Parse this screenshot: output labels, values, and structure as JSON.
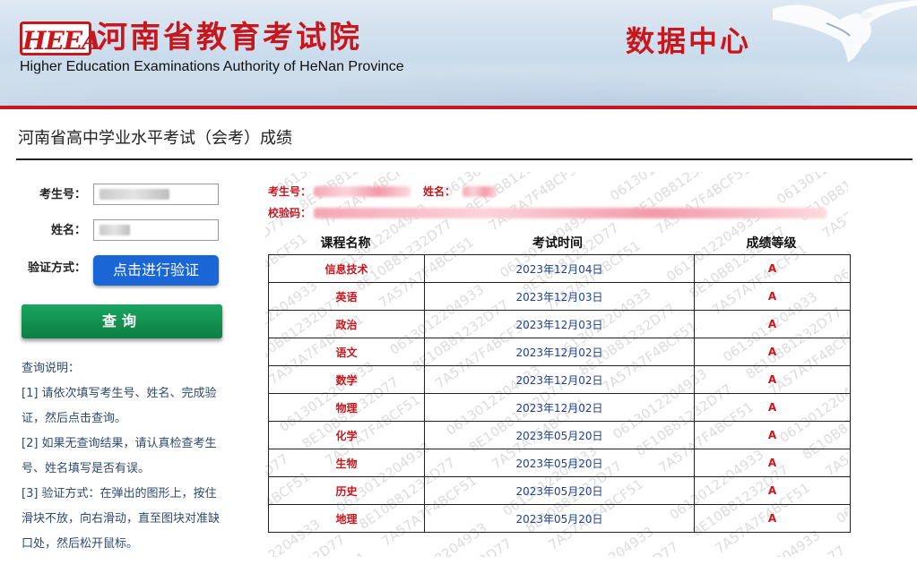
{
  "header": {
    "logo_text": "HEEA",
    "org_name_cn": "河南省教育考试院",
    "org_name_en": "Higher Education Examinations Authority of HeNan Province",
    "section_title": "数据中心"
  },
  "page": {
    "title": "河南省高中学业水平考试（会考）成绩"
  },
  "form": {
    "exam_no_label": "考生号：",
    "name_label": "姓名：",
    "verify_label": "验证方式：",
    "verify_button": "点击进行验证",
    "query_button": "查询"
  },
  "notes": {
    "heading": "查询说明：",
    "items": [
      "[1] 请依次填写考生号、姓名、完成验证，然后点击查询。",
      "[2] 如果无查询结果，请认真检查考生号、姓名填写是否有误。",
      "[3] 验证方式：在弹出的图形上，按住滑块不放，向右滑动，直至图块对准缺口处，然后松开鼠标。"
    ]
  },
  "result": {
    "exam_no_label": "考生号：",
    "name_label": "姓名：",
    "checksum_label": "校验码：",
    "columns": [
      "课程名称",
      "考试时间",
      "成绩等级"
    ],
    "rows": [
      {
        "course": "信息技术",
        "date": "2023年12月04日",
        "grade": "A"
      },
      {
        "course": "英语",
        "date": "2023年12月03日",
        "grade": "A"
      },
      {
        "course": "政治",
        "date": "2023年12月03日",
        "grade": "A"
      },
      {
        "course": "语文",
        "date": "2023年12月02日",
        "grade": "A"
      },
      {
        "course": "数学",
        "date": "2023年12月02日",
        "grade": "A"
      },
      {
        "course": "物理",
        "date": "2023年12月02日",
        "grade": "A"
      },
      {
        "course": "化学",
        "date": "2023年05月20日",
        "grade": "A"
      },
      {
        "course": "生物",
        "date": "2023年05月20日",
        "grade": "A"
      },
      {
        "course": "历史",
        "date": "2023年05月20日",
        "grade": "A"
      },
      {
        "course": "地理",
        "date": "2023年05月20日",
        "grade": "A"
      }
    ]
  },
  "colors": {
    "brand_red": "#c8161d",
    "verify_blue": "#1a66d6",
    "query_green": "#0d7f42",
    "date_blue": "#1e3f8f"
  },
  "icons": {
    "eagle": "eagle-icon"
  }
}
